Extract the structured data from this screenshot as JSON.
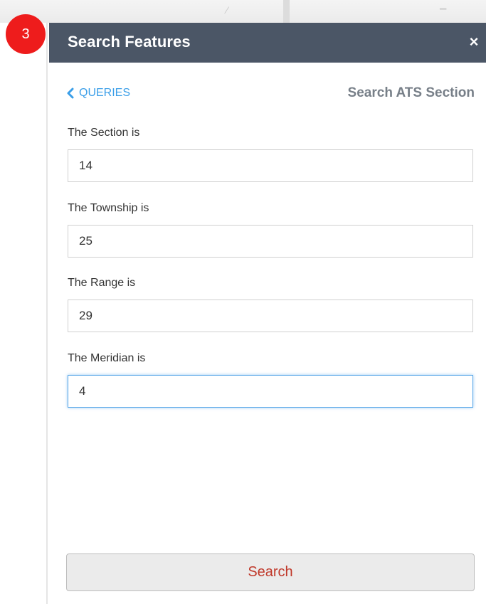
{
  "step_badge": "3",
  "panel": {
    "title": "Search Features",
    "close_glyph": "×"
  },
  "nav": {
    "back_label": "QUERIES",
    "back_icon": "chevron-left-icon",
    "query_title": "Search ATS Section"
  },
  "fields": [
    {
      "label": "The Section is",
      "value": "14"
    },
    {
      "label": "The Township is",
      "value": "25"
    },
    {
      "label": "The Range is",
      "value": "29"
    },
    {
      "label": "The Meridian is",
      "value": "4"
    }
  ],
  "actions": {
    "search_label": "Search"
  },
  "colors": {
    "header_bg": "#4b5666",
    "badge_red": "#ee1c1c",
    "link_blue": "#3a9ee8",
    "search_text": "#c0392b",
    "focus_border": "#58a6e8"
  }
}
